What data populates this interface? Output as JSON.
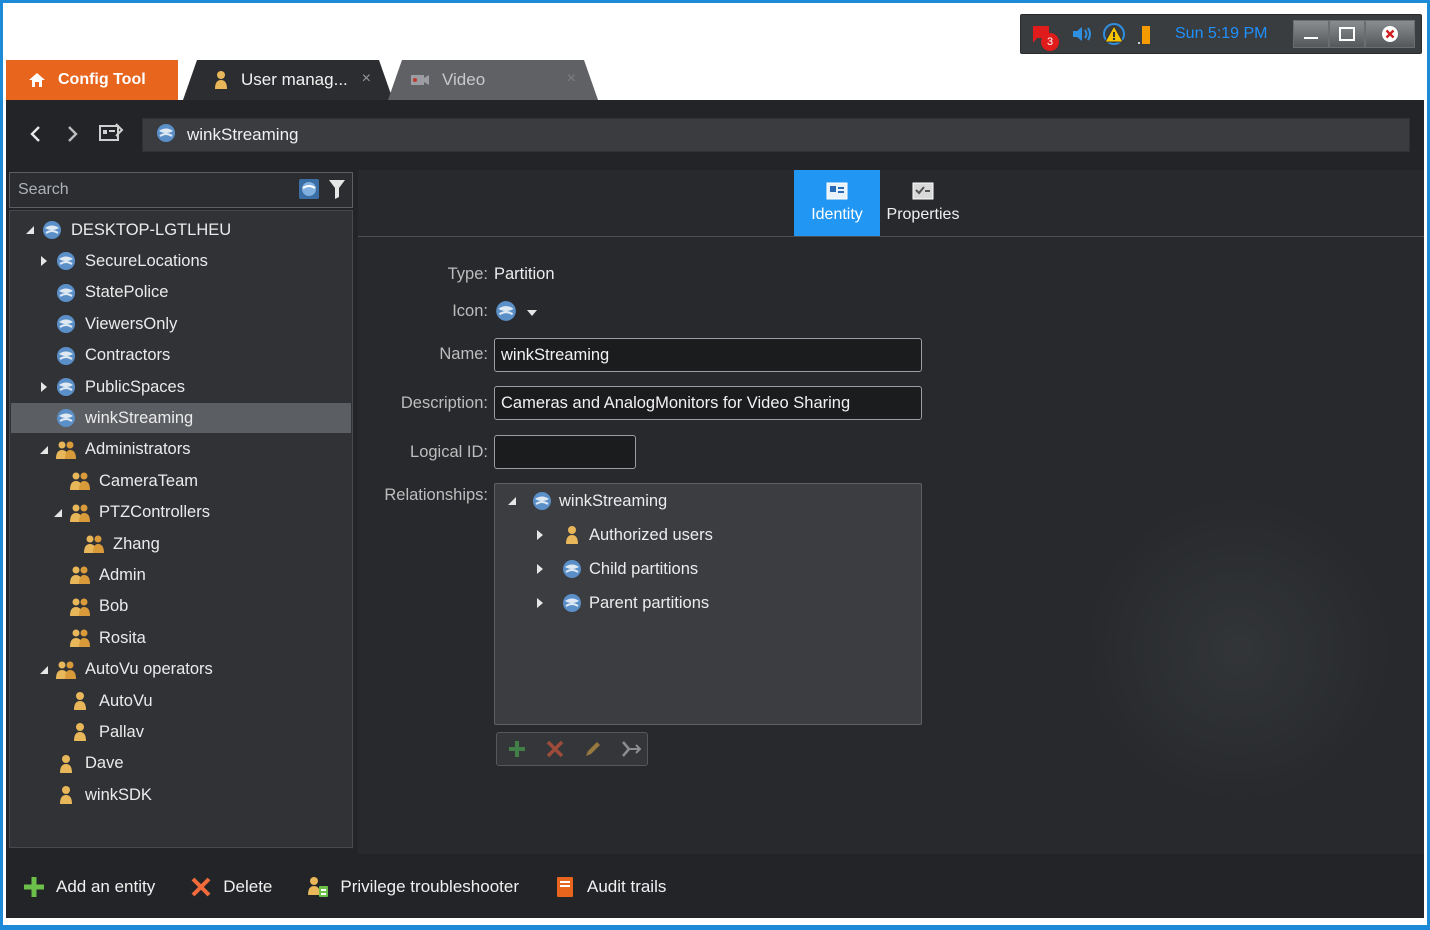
{
  "tray": {
    "notification_count": "3",
    "clock": "Sun 5:19 PM"
  },
  "tabs": {
    "home_label": "Config Tool",
    "active_label": "User manag...",
    "inactive_label": "Video",
    "close_glyph": "×"
  },
  "address": {
    "entity": "winkStreaming"
  },
  "search": {
    "placeholder": "Search"
  },
  "tree": [
    {
      "label": "DESKTOP-LGTLHEU",
      "level": 0,
      "expander": "expanded",
      "icon": "partition-icon"
    },
    {
      "label": "SecureLocations",
      "level": 1,
      "expander": "collapsed",
      "icon": "partition-icon"
    },
    {
      "label": "StatePolice",
      "level": 1,
      "expander": "none",
      "icon": "partition-icon"
    },
    {
      "label": "ViewersOnly",
      "level": 1,
      "expander": "none",
      "icon": "partition-icon"
    },
    {
      "label": "Contractors",
      "level": 1,
      "expander": "none",
      "icon": "partition-icon"
    },
    {
      "label": "PublicSpaces",
      "level": 1,
      "expander": "collapsed",
      "icon": "partition-icon"
    },
    {
      "label": "winkStreaming",
      "level": 1,
      "expander": "none",
      "icon": "partition-icon",
      "selected": true
    },
    {
      "label": "Administrators",
      "level": 1,
      "expander": "expanded",
      "icon": "user-group-icon"
    },
    {
      "label": "CameraTeam",
      "level": 2,
      "expander": "none",
      "icon": "user-group-icon"
    },
    {
      "label": "PTZControllers",
      "level": 2,
      "expander": "expanded",
      "icon": "user-group-icon"
    },
    {
      "label": "Zhang",
      "level": 3,
      "expander": "none",
      "icon": "user-group-icon"
    },
    {
      "label": "Admin",
      "level": 2,
      "expander": "none",
      "icon": "user-group-icon"
    },
    {
      "label": "Bob",
      "level": 2,
      "expander": "none",
      "icon": "user-group-icon"
    },
    {
      "label": "Rosita",
      "level": 2,
      "expander": "none",
      "icon": "user-group-icon"
    },
    {
      "label": "AutoVu operators",
      "level": 1,
      "expander": "expanded",
      "icon": "user-group-icon"
    },
    {
      "label": "AutoVu",
      "level": 2,
      "expander": "none",
      "icon": "user-icon"
    },
    {
      "label": "Pallav",
      "level": 2,
      "expander": "none",
      "icon": "user-icon"
    },
    {
      "label": "Dave",
      "level": 1,
      "expander": "none",
      "icon": "user-icon"
    },
    {
      "label": "winkSDK",
      "level": 1,
      "expander": "none",
      "icon": "user-icon"
    }
  ],
  "page_tabs": {
    "identity": "Identity",
    "properties": "Properties"
  },
  "identity": {
    "type_label": "Type:",
    "type_value": "Partition",
    "icon_label": "Icon:",
    "name_label": "Name:",
    "name_value": "winkStreaming",
    "description_label": "Description:",
    "description_value": "Cameras and AnalogMonitors for Video Sharing",
    "logical_id_label": "Logical ID:",
    "logical_id_value": "",
    "relationships_label": "Relationships:"
  },
  "relationships": {
    "root": "winkStreaming",
    "children": [
      "Authorized users",
      "Child partitions",
      "Parent partitions"
    ]
  },
  "bottom_toolbar": {
    "add": "Add an entity",
    "delete": "Delete",
    "privilege": "Privilege troubleshooter",
    "audit": "Audit trails"
  },
  "colors": {
    "accent_orange": "#e8651e",
    "accent_blue": "#2196f3",
    "background": "#222427",
    "panel": "#303236",
    "selected_row": "#5b5e62",
    "frame_blue": "#1c8ad6"
  }
}
